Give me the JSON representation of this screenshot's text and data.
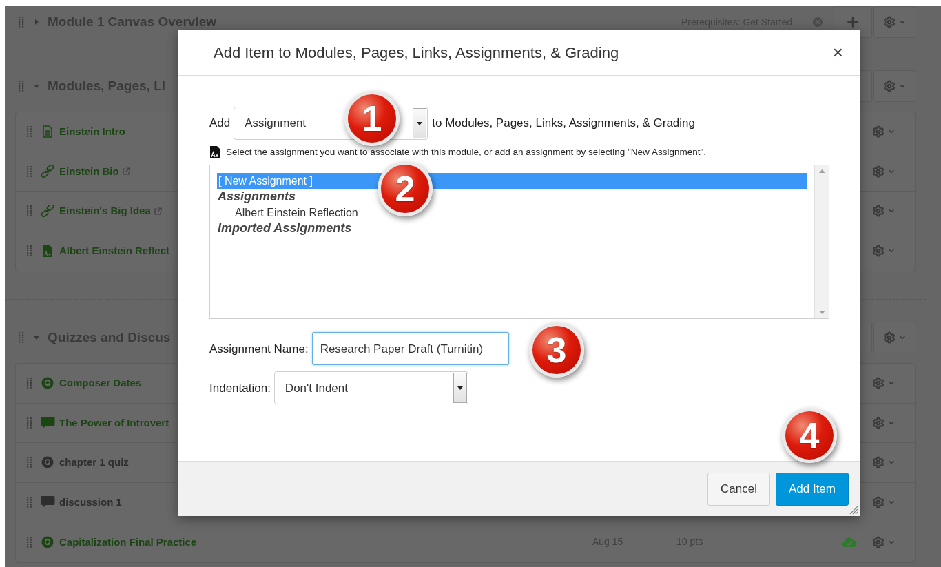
{
  "modules": [
    {
      "title": "Module 1 Canvas Overview",
      "expanded": false,
      "prerequisites": "Prerequisites: Get Started"
    },
    {
      "title": "Modules, Pages, Li",
      "expanded": true,
      "items": [
        {
          "kind": "page",
          "title": "Einstein Intro",
          "published": true,
          "external": false
        },
        {
          "kind": "link",
          "title": "Einstein Bio",
          "published": true,
          "external": true
        },
        {
          "kind": "link",
          "title": "Einstein's Big Idea",
          "published": true,
          "external": true
        },
        {
          "kind": "assignment",
          "title": "Albert Einstein Reflect",
          "published": true,
          "external": false
        }
      ]
    },
    {
      "title": "Quizzes and Discus",
      "expanded": true,
      "items": [
        {
          "kind": "quiz",
          "title": "Composer Dates",
          "published": true,
          "external": false
        },
        {
          "kind": "discussion",
          "title": "The Power of Introvert",
          "published": true,
          "external": false
        },
        {
          "kind": "quiz",
          "title": "chapter 1 quiz",
          "published": false,
          "external": false
        },
        {
          "kind": "discussion",
          "title": "discussion 1",
          "published": false,
          "external": false
        },
        {
          "kind": "quiz",
          "title": "Capitalization Final Practice",
          "published": true,
          "external": false,
          "due": "Aug 15",
          "points": "10 pts",
          "publish_icon": true
        }
      ]
    }
  ],
  "dialog": {
    "title": "Add Item to Modules, Pages, Links, Assignments, & Grading",
    "close": "×",
    "add_label": "Add",
    "item_type": "Assignment",
    "add_suffix": "to Modules, Pages, Links, Assignments, & Grading",
    "instruction": "Select the assignment you want to associate with this module, or add an assignment by selecting \"New Assignment\".",
    "options": [
      {
        "kind": "option",
        "label": "[ New Assignment ]",
        "selected": true
      },
      {
        "kind": "group",
        "label": "Assignments"
      },
      {
        "kind": "option",
        "label": "Albert Einstein Reflection",
        "selected": false
      },
      {
        "kind": "group",
        "label": "Imported Assignments"
      }
    ],
    "name_label": "Assignment Name:",
    "name_value": "Research Paper Draft (Turnitin)",
    "indent_label": "Indentation:",
    "indent_value": "Don't Indent",
    "buttons": [
      {
        "kind": "secondary",
        "label": "Cancel"
      },
      {
        "kind": "primary",
        "label": "Add Item"
      }
    ]
  },
  "callouts": [
    "1",
    "2",
    "3",
    "4"
  ]
}
